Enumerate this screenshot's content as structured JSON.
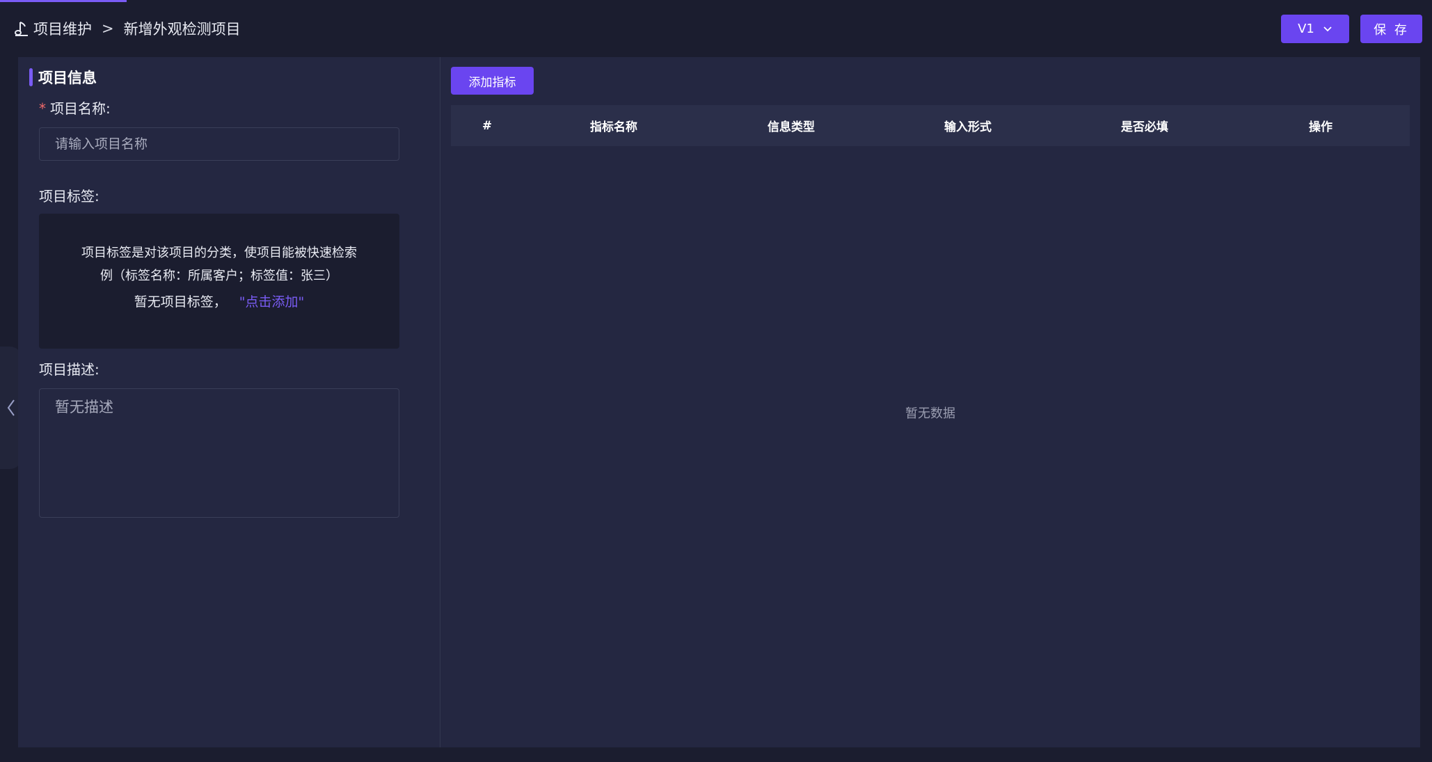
{
  "breadcrumb": {
    "parent": "项目维护",
    "separator": ">",
    "current": "新增外观检测项目"
  },
  "header": {
    "version_label": "V1",
    "save_label": "保 存"
  },
  "left": {
    "section_title": "项目信息",
    "name_label": "项目名称:",
    "name_placeholder": "请输入项目名称",
    "tags_label": "项目标签:",
    "tags_hint_line1": "项目标签是对该项目的分类，使项目能被快速检索",
    "tags_hint_line2": "例（标签名称：所属客户；标签值：张三）",
    "tags_empty": "暂无项目标签，",
    "tags_add_link": "\"点击添加\"",
    "desc_label": "项目描述:",
    "desc_placeholder": "暂无描述"
  },
  "right": {
    "add_button": "添加指标",
    "columns": [
      "#",
      "指标名称",
      "信息类型",
      "输入形式",
      "是否必填",
      "操作"
    ],
    "empty_text": "暂无数据"
  },
  "colors": {
    "accent": "#6a45f0",
    "background": "#1b1d2f",
    "panel": "#242741",
    "required": "#f06a6a"
  }
}
